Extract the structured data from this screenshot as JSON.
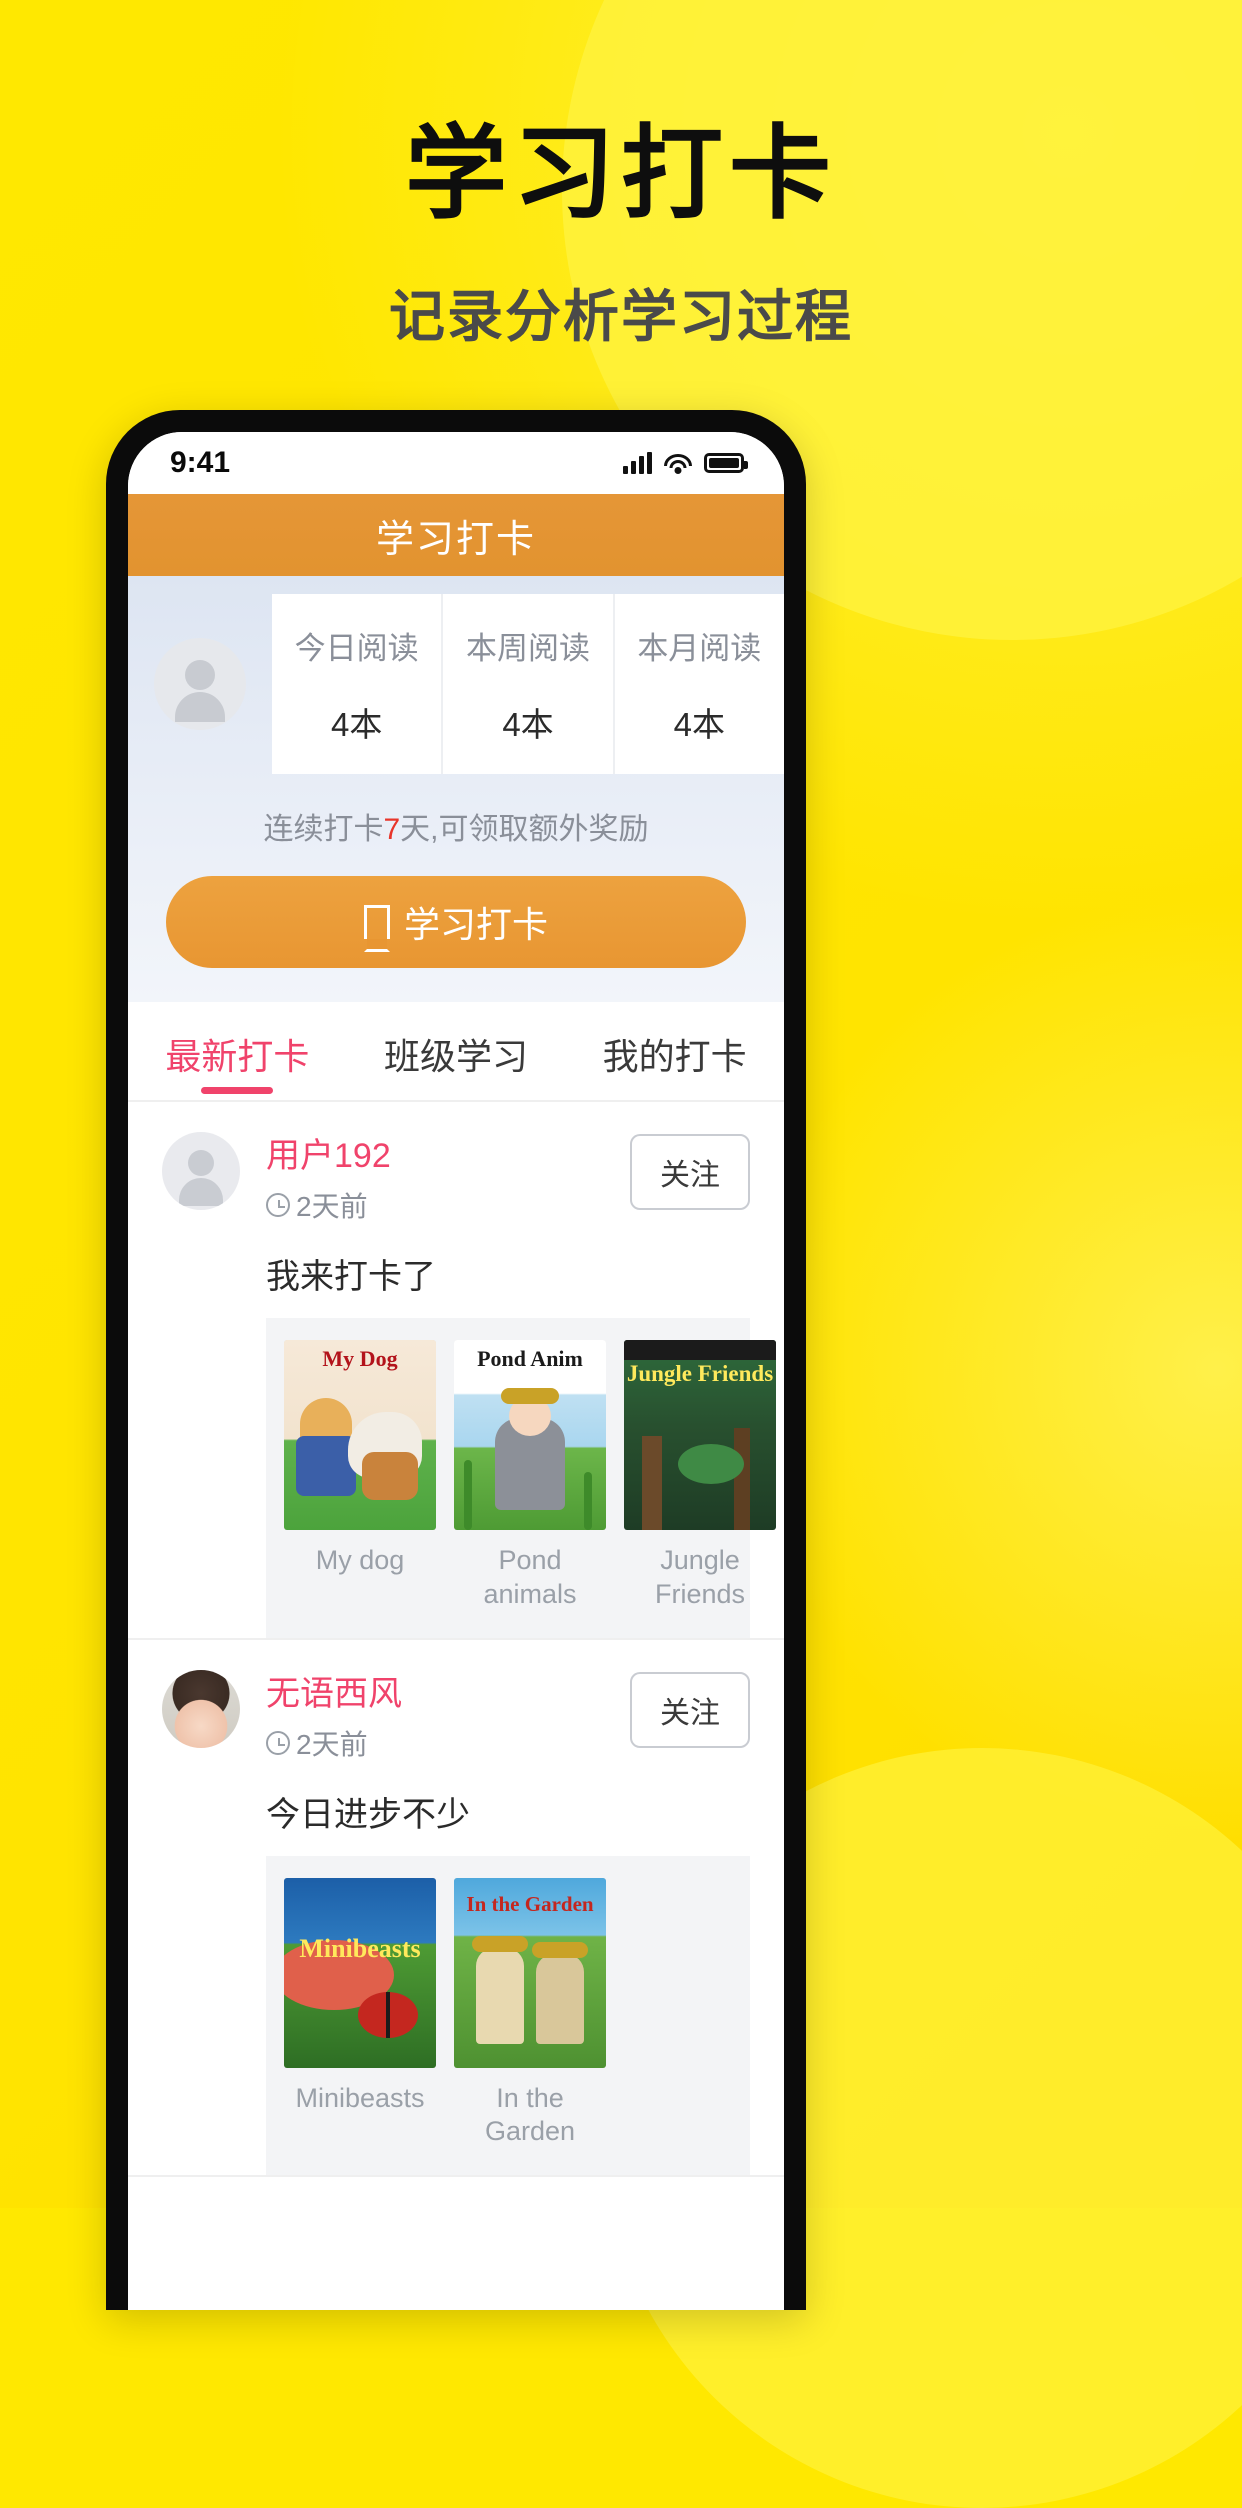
{
  "promo": {
    "title": "学习打卡",
    "subtitle": "记录分析学习过程"
  },
  "colors": {
    "background": "#FFE800",
    "header_orange": "#E2932F",
    "accent_pink": "#F0436B",
    "streak_red": "#E8352A",
    "button_orange": "#E89632"
  },
  "status_bar": {
    "time": "9:41",
    "signal_icon": "signal-bars-icon",
    "wifi_icon": "wifi-icon",
    "battery_icon": "battery-full-icon"
  },
  "app_header": {
    "title": "学习打卡"
  },
  "summary": {
    "avatar_icon": "user-placeholder-avatar",
    "stats": [
      {
        "label": "今日阅读",
        "value": "4本"
      },
      {
        "label": "本周阅读",
        "value": "4本"
      },
      {
        "label": "本月阅读",
        "value": "4本"
      }
    ],
    "streak_prefix": "连续打卡",
    "streak_days": "7",
    "streak_suffix": "天,可领取额外奖励",
    "checkin_button": {
      "icon": "bookmark-icon",
      "label": "学习打卡"
    }
  },
  "tabs": [
    {
      "label": "最新打卡",
      "active": true
    },
    {
      "label": "班级学习",
      "active": false
    },
    {
      "label": "我的打卡",
      "active": false
    }
  ],
  "feed": {
    "follow_label": "关注",
    "posts": [
      {
        "user": "用户192",
        "time": "2天前",
        "time_icon": "clock-icon",
        "avatar_type": "placeholder",
        "text": "我来打卡了",
        "books": [
          {
            "caption": "My dog",
            "cover_title": "My Dog"
          },
          {
            "caption": "Pond animals",
            "cover_title": "Pond Anim"
          },
          {
            "caption": "Jungle Friends",
            "cover_title": "Jungle Friends"
          }
        ]
      },
      {
        "user": "无语西风",
        "time": "2天前",
        "time_icon": "clock-icon",
        "avatar_type": "photo",
        "text": "今日进步不少",
        "books": [
          {
            "caption": "Minibeasts",
            "cover_title": "Minibeasts"
          },
          {
            "caption": "In the Garden",
            "cover_title": "In the Garden"
          }
        ]
      }
    ]
  }
}
